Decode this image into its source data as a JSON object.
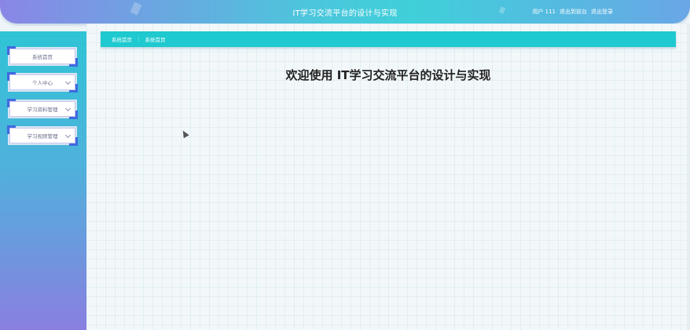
{
  "header": {
    "title": "IT学习交流平台的设计与实现",
    "user": "用户 111",
    "exit_frontend": "退出到前台",
    "logout": "退出登录"
  },
  "sidebar": {
    "items": [
      {
        "label": "系统首页",
        "has_submenu": false
      },
      {
        "label": "个人中心",
        "has_submenu": true
      },
      {
        "label": "学习资料管理",
        "has_submenu": true
      },
      {
        "label": "学习视频管理",
        "has_submenu": true
      }
    ]
  },
  "breadcrumb": {
    "home": "系统首页",
    "separator": "⋮",
    "current": "系统首页"
  },
  "main": {
    "welcome": "欢迎使用 IT学习交流平台的设计与实现"
  },
  "colors": {
    "breadcrumb_bg": "#1ec9cf",
    "menu_corner": "#3e6ae0"
  }
}
